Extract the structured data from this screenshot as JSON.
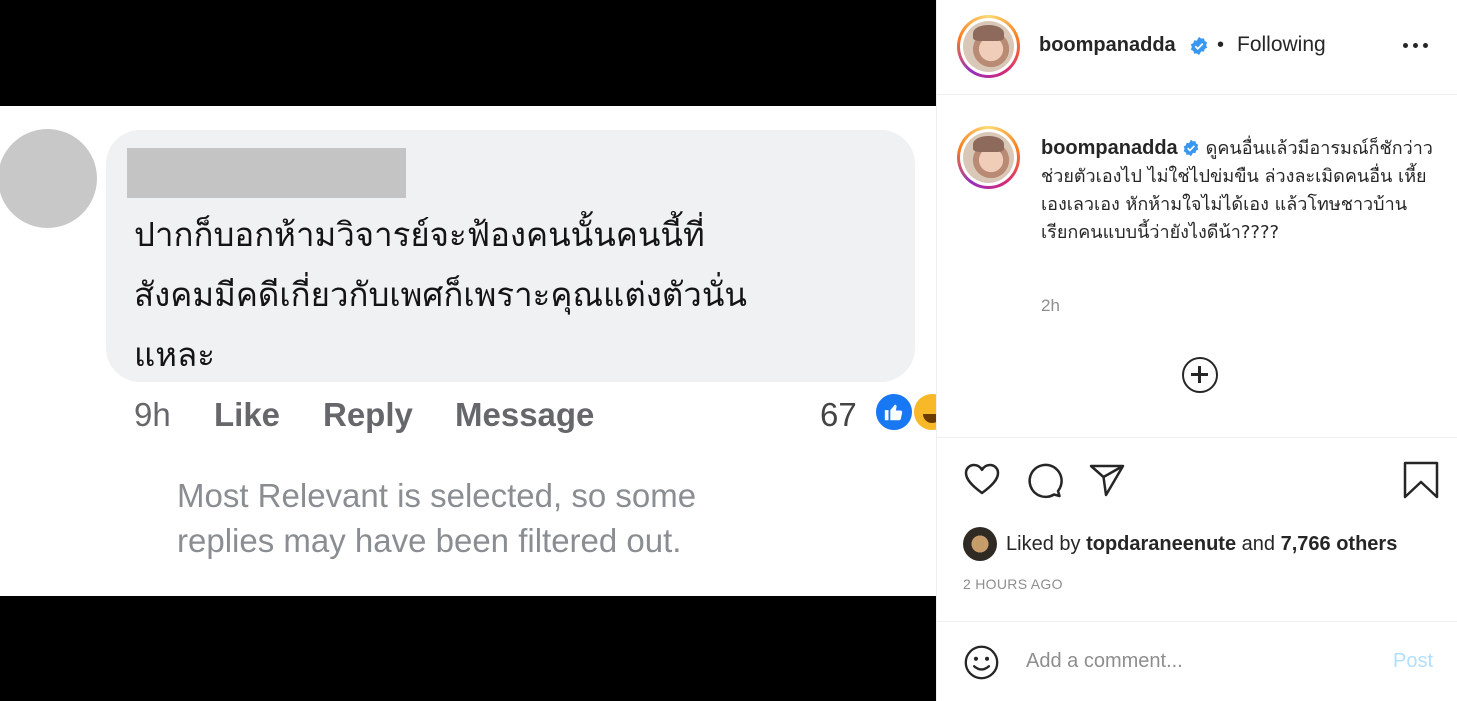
{
  "media": {
    "comment_text": "ปากก็บอกห้ามวิจารย์จะฟ้องคนนั้นคนนี้ที่\nสังคมมีคดีเกี่ยวกับเพศก็เพราะคุณแต่งตัวนั่น\nแหละ",
    "time": "9h",
    "like_label": "Like",
    "reply_label": "Reply",
    "message_label": "Message",
    "reaction_count": "67",
    "filter_note": "Most Relevant is selected, so some\nreplies may have been filtered out."
  },
  "header": {
    "username": "boompanadda",
    "separator": "•",
    "follow_status": "Following"
  },
  "caption": {
    "username": "boompanadda",
    "text": "ดูคนอื่นแล้วมีอารมณ์ก็ชักว่าวช่วยตัวเองไป ไม่ใช่ไปข่มขืน ล่วงละเมิดคนอื่น เหี้ยเองเลวเอง หักห้ามใจไม่ได้เอง แล้วโทษชาวบ้าน เรียกคนแบบนี้ว่ายังไงดีน้า????",
    "time": "2h"
  },
  "likes": {
    "prefix": "Liked by",
    "user": "topdaraneenute",
    "middle": "and",
    "others": "7,766 others"
  },
  "post_time": "2 HOURS AGO",
  "comment_box": {
    "placeholder": "Add a comment...",
    "post_label": "Post"
  },
  "colors": {
    "verified": "#3897f0",
    "post_button_disabled": "#b2dffc",
    "fb_like_blue": "#1877f2"
  }
}
